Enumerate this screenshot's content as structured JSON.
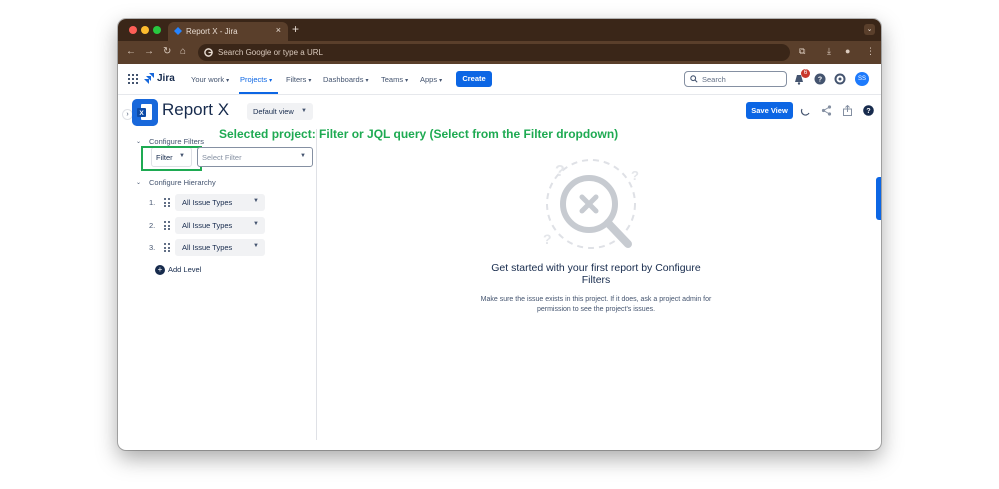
{
  "browser": {
    "tab_title": "Report X - Jira",
    "tab_close": "×",
    "new_tab": "+",
    "address_placeholder": "Search Google or type a URL",
    "tab_menu": "⌄"
  },
  "jira_nav": {
    "logo": "Jira",
    "items": [
      {
        "label": "Your work"
      },
      {
        "label": "Projects"
      },
      {
        "label": "Filters"
      },
      {
        "label": "Dashboards"
      },
      {
        "label": "Teams"
      },
      {
        "label": "Apps"
      }
    ],
    "active_item": "Projects",
    "create": "Create",
    "search_placeholder": "Search",
    "notification_count": "6",
    "avatar_initials": "SS"
  },
  "report": {
    "title": "Report X",
    "view_selector": "Default view",
    "save_view": "Save View"
  },
  "left_panel": {
    "configure_filters": "Configure Filters",
    "filter_type": "Filter",
    "filter_placeholder": "Select Filter",
    "configure_hierarchy": "Configure Hierarchy",
    "levels": [
      {
        "num": "1.",
        "type": "All Issue Types"
      },
      {
        "num": "2.",
        "type": "All Issue Types"
      },
      {
        "num": "3.",
        "type": "All Issue Types"
      }
    ],
    "add_level": "Add Level"
  },
  "annotation": "Selected project: Filter or JQL query (Select from the Filter dropdown)",
  "empty_state": {
    "title": "Get started with your first report by Configure Filters",
    "description": "Make sure the issue exists in this project. If it does, ask a project admin for permission to see the project's issues."
  },
  "colors": {
    "accent": "#0c66e4",
    "annotation": "#1eaa52",
    "browser_chrome": "#3a2618"
  },
  "icons": [
    "apps-grid-icon",
    "jira-logo-icon",
    "search-icon",
    "notification-icon",
    "help-icon",
    "settings-icon",
    "report-x-logo",
    "share-icon",
    "export-icon",
    "drag-handle-icon",
    "add-icon",
    "empty-search-illustration"
  ]
}
